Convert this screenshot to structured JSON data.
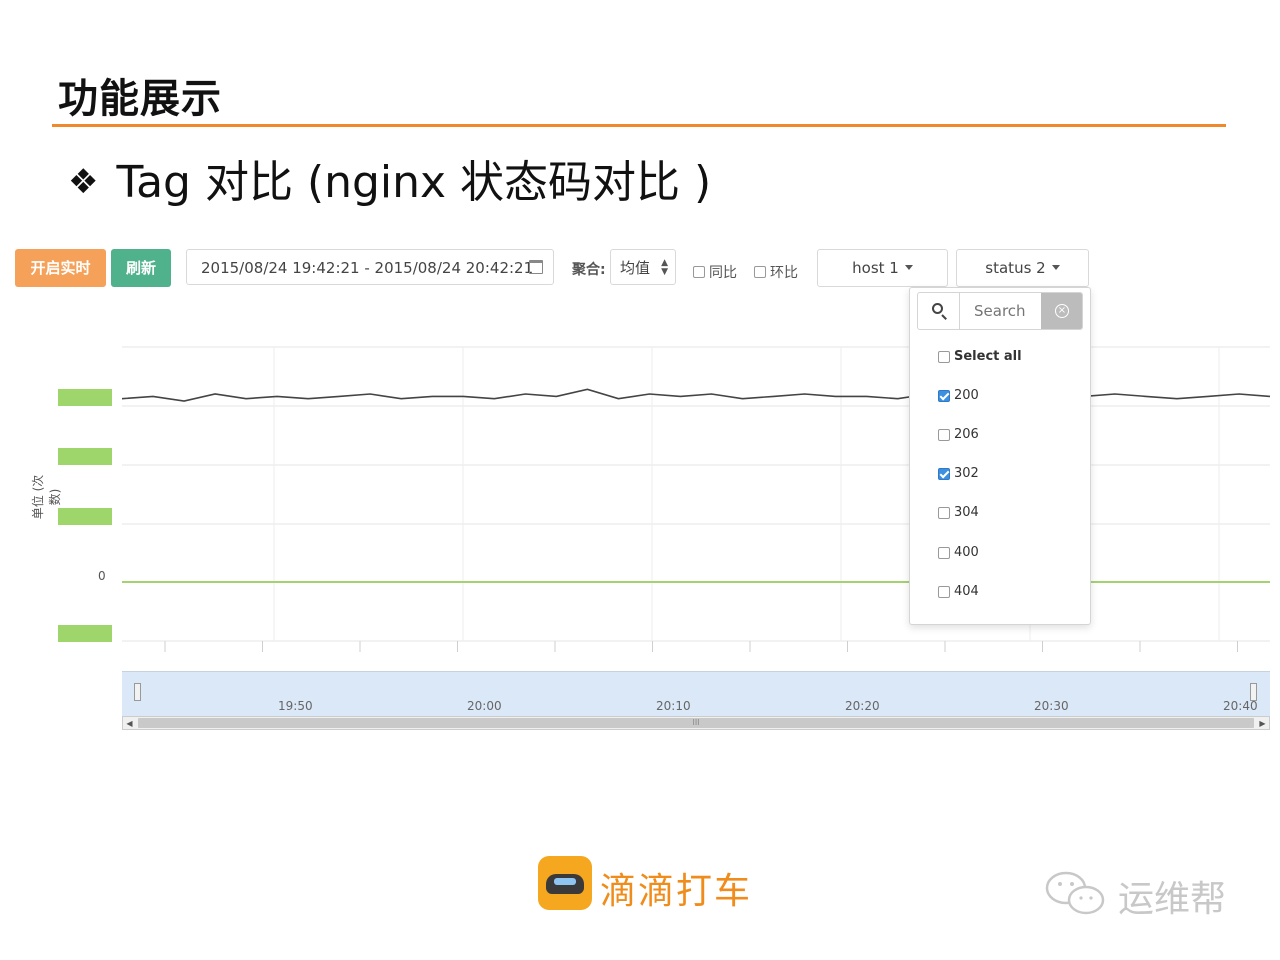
{
  "slide": {
    "title": "功能展示",
    "bullet_mark": "❖",
    "bullet_text": "Tag 对比 (nginx 状态码对比 )",
    "accent_color": "#ef8a2c"
  },
  "toolbar": {
    "live_button": "开启实时",
    "refresh_button": "刷新",
    "date_range": "2015/08/24 19:42:21 - 2015/08/24 20:42:21",
    "aggregate_label": "聚合:",
    "aggregate_value": "均值",
    "compare_yoy": "同比",
    "compare_mom": "环比",
    "host_dropdown": "host 1",
    "status_dropdown": "status 2",
    "live_color": "#f5a15a",
    "refresh_color": "#4fb28c"
  },
  "status_menu": {
    "search_placeholder": "Search",
    "options": [
      {
        "label": "Select all",
        "checked": false
      },
      {
        "label": "200",
        "checked": true
      },
      {
        "label": "206",
        "checked": false
      },
      {
        "label": "302",
        "checked": true
      },
      {
        "label": "304",
        "checked": false
      },
      {
        "label": "400",
        "checked": false
      },
      {
        "label": "404",
        "checked": false
      }
    ]
  },
  "chart": {
    "ylabel": "单位 (次数)",
    "zero_tick": "0",
    "navigator_ticks": [
      "19:50",
      "20:00",
      "20:10",
      "20:20",
      "20:30",
      "20:40"
    ],
    "scroll_grip": "III"
  },
  "chart_data": {
    "type": "line",
    "ylabel": "单位 (次数)",
    "series": [
      {
        "name": "",
        "color": "#444444",
        "values": [
          0.78,
          0.79,
          0.77,
          0.8,
          0.78,
          0.79,
          0.78,
          0.79,
          0.8,
          0.78,
          0.79,
          0.79,
          0.78,
          0.8,
          0.79,
          0.82,
          0.78,
          0.8,
          0.79,
          0.8,
          0.78,
          0.79,
          0.8,
          0.79,
          0.79,
          0.78,
          0.8,
          0.79,
          0.79,
          0.8,
          0.78,
          0.79,
          0.8,
          0.79,
          0.78,
          0.79,
          0.8,
          0.79
        ]
      },
      {
        "name": "",
        "color": "#a3d36f",
        "values": [
          0,
          0,
          0,
          0,
          0,
          0,
          0,
          0,
          0,
          0,
          0,
          0,
          0,
          0,
          0,
          0,
          0,
          0,
          0,
          0,
          0,
          0,
          0,
          0,
          0,
          0,
          0,
          0,
          0,
          0,
          0,
          0,
          0,
          0,
          0,
          0,
          0,
          0
        ]
      }
    ]
  },
  "footer": {
    "brand_text": "滴滴打车",
    "watermark_text": "运维帮",
    "brand_color": "#f08c1b"
  }
}
